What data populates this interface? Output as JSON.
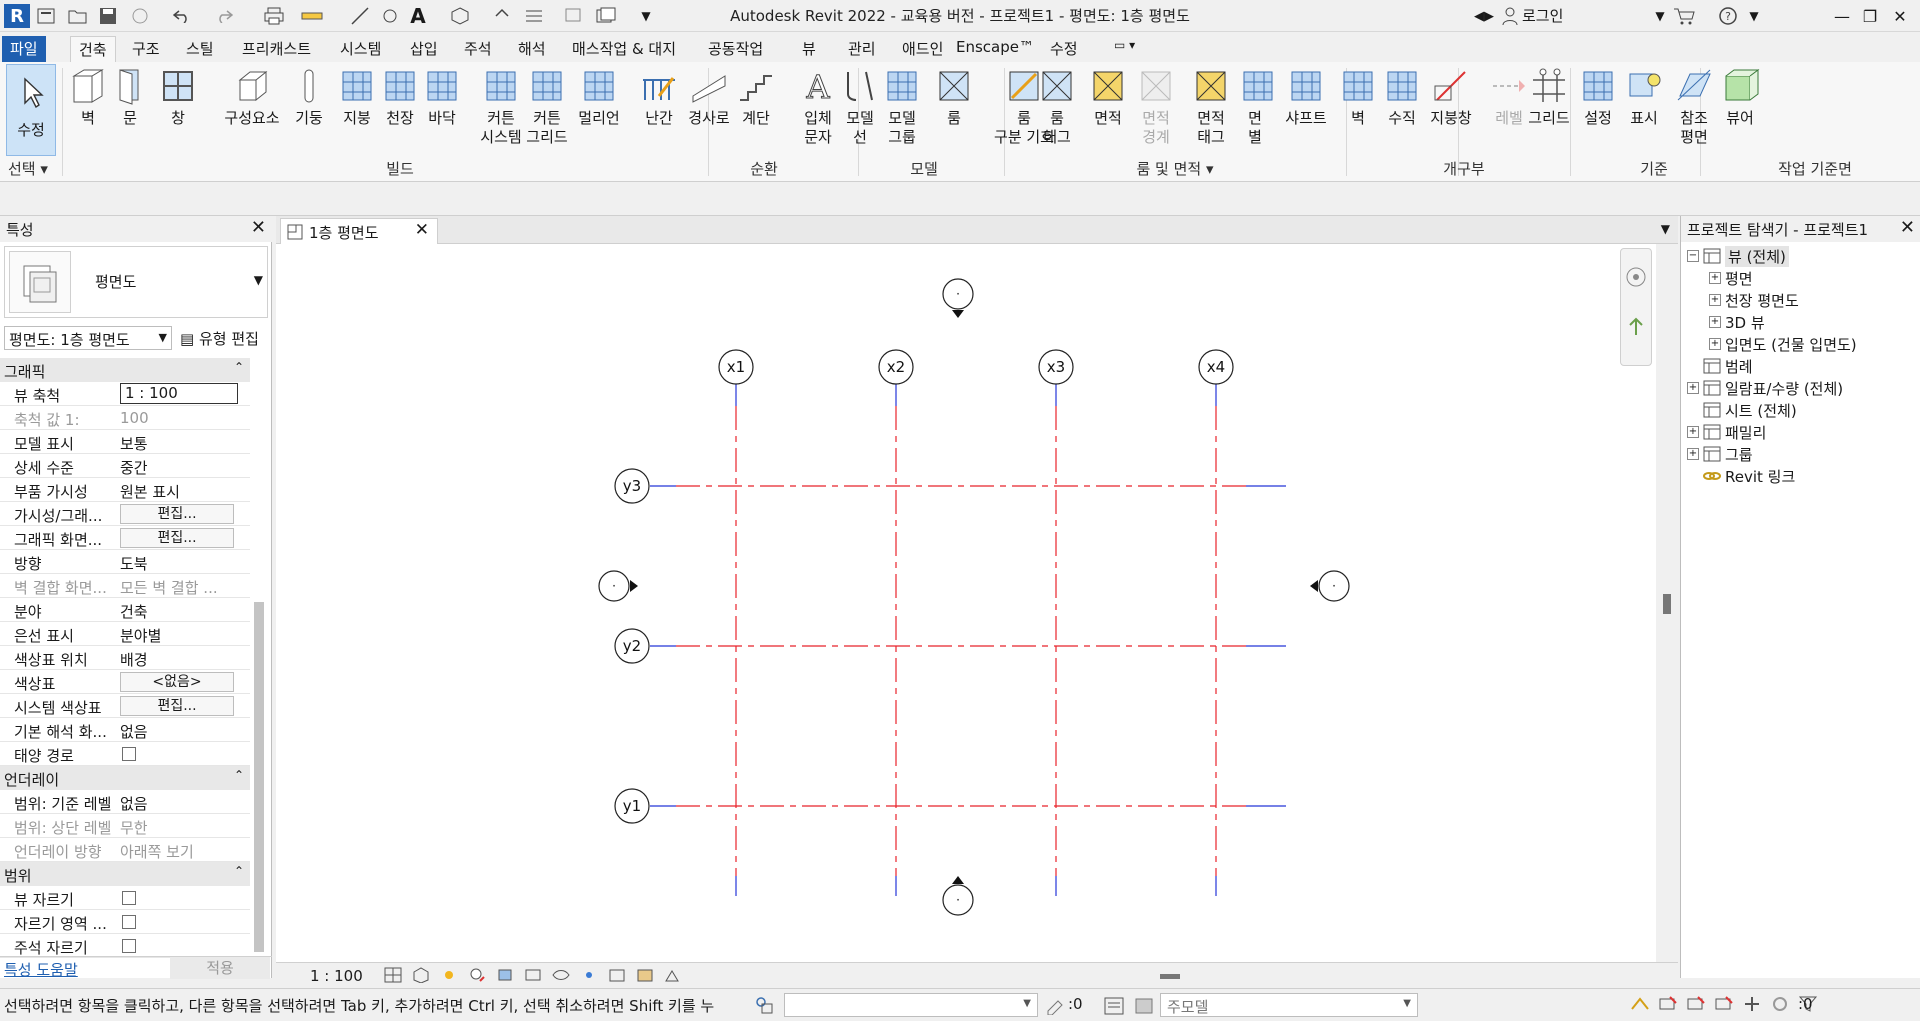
{
  "window": {
    "title": "Autodesk Revit 2022 - 교육용 버전 - 프로젝트1 - 평면도: 1층 평면도",
    "login": "로그인",
    "app_letter": "R"
  },
  "ribbon_tabs": [
    "파일",
    "건축",
    "구조",
    "스틸",
    "프리캐스트",
    "시스템",
    "삽입",
    "주석",
    "해석",
    "매스작업 & 대지",
    "공동작업",
    "뷰",
    "관리",
    "애드인",
    "Enscape™",
    "수정"
  ],
  "ribbon": {
    "select_label": "수정",
    "select_group": "선택",
    "groups": {
      "build": "빌드",
      "circulation": "순환",
      "model": "모델",
      "room_area": "룸 및 면적",
      "opening": "개구부",
      "datum": "기준",
      "work_plane": "작업 기준면"
    },
    "tools": [
      {
        "icon": "wall-icon",
        "line1": "벽",
        "line2": ""
      },
      {
        "icon": "door-icon",
        "line1": "문",
        "line2": ""
      },
      {
        "icon": "window-icon",
        "line1": "창",
        "line2": ""
      },
      {
        "icon": "component-icon",
        "line1": "구성요소",
        "line2": ""
      },
      {
        "icon": "column-icon",
        "line1": "기둥",
        "line2": ""
      },
      {
        "icon": "roof-icon",
        "line1": "지붕",
        "line2": ""
      },
      {
        "icon": "ceiling-icon",
        "line1": "천장",
        "line2": ""
      },
      {
        "icon": "floor-icon",
        "line1": "바닥",
        "line2": ""
      },
      {
        "icon": "curtain-system-icon",
        "line1": "커튼",
        "line2": "시스템"
      },
      {
        "icon": "curtain-grid-icon",
        "line1": "커튼",
        "line2": "그리드"
      },
      {
        "icon": "mullion-icon",
        "line1": "멀리언",
        "line2": ""
      },
      {
        "icon": "railing-icon",
        "line1": "난간",
        "line2": ""
      },
      {
        "icon": "ramp-icon",
        "line1": "경사로",
        "line2": ""
      },
      {
        "icon": "stair-icon",
        "line1": "계단",
        "line2": ""
      },
      {
        "icon": "model-text-icon",
        "line1": "입체",
        "line2": "문자"
      },
      {
        "icon": "model-line-icon",
        "line1": "모델",
        "line2": "선"
      },
      {
        "icon": "model-group-icon",
        "line1": "모델",
        "line2": "그룹"
      },
      {
        "icon": "room-icon",
        "line1": "룸",
        "line2": ""
      },
      {
        "icon": "room-separator-icon",
        "line1": "룸",
        "line2": "구분 기호"
      },
      {
        "icon": "room-tag-icon",
        "line1": "룸",
        "line2": "태그"
      },
      {
        "icon": "area-icon",
        "line1": "면적",
        "line2": ""
      },
      {
        "icon": "area-boundary-icon",
        "line1": "면적",
        "line2": "경계"
      },
      {
        "icon": "area-tag-icon",
        "line1": "면적",
        "line2": "태그"
      },
      {
        "icon": "by-face-icon",
        "line1": "면",
        "line2": "별"
      },
      {
        "icon": "shaft-icon",
        "line1": "샤프트",
        "line2": ""
      },
      {
        "icon": "wall-opening-icon",
        "line1": "벽",
        "line2": ""
      },
      {
        "icon": "vertical-opening-icon",
        "line1": "수직",
        "line2": ""
      },
      {
        "icon": "dormer-icon",
        "line1": "지붕창",
        "line2": ""
      },
      {
        "icon": "level-icon",
        "line1": "레벨",
        "line2": ""
      },
      {
        "icon": "grid-icon",
        "line1": "그리드",
        "line2": ""
      },
      {
        "icon": "set-workplane-icon",
        "line1": "설정",
        "line2": ""
      },
      {
        "icon": "show-workplane-icon",
        "line1": "표시",
        "line2": ""
      },
      {
        "icon": "ref-plane-icon",
        "line1": "참조",
        "line2": "평면"
      },
      {
        "icon": "viewer-icon",
        "line1": "뷰어",
        "line2": ""
      }
    ]
  },
  "properties": {
    "panel_title": "특성",
    "type_name": "평면도",
    "instance_selector": "평면도: 1층 평면도",
    "edit_type": "유형 편집",
    "sections": {
      "graphics": "그래픽",
      "underlay": "언더레이",
      "extents": "범위"
    },
    "graphics_rows": [
      {
        "k": "뷰 축척",
        "v": "1 : 100",
        "kind": "input"
      },
      {
        "k": "축척 값    1:",
        "v": "100",
        "kind": "dim"
      },
      {
        "k": "모델 표시",
        "v": "보통",
        "kind": "text"
      },
      {
        "k": "상세 수준",
        "v": "중간",
        "kind": "text"
      },
      {
        "k": "부품 가시성",
        "v": "원본 표시",
        "kind": "text"
      },
      {
        "k": "가시성/그래...",
        "v": "편집...",
        "kind": "button"
      },
      {
        "k": "그래픽 화면...",
        "v": "편집...",
        "kind": "button"
      },
      {
        "k": "방향",
        "v": "도북",
        "kind": "text"
      },
      {
        "k": "벽 결합 화면...",
        "v": "모든 벽 결합 ...",
        "kind": "dim"
      },
      {
        "k": "분야",
        "v": "건축",
        "kind": "text"
      },
      {
        "k": "은선 표시",
        "v": "분야별",
        "kind": "text"
      },
      {
        "k": "색상표 위치",
        "v": "배경",
        "kind": "text"
      },
      {
        "k": "색상표",
        "v": "<없음>",
        "kind": "button"
      },
      {
        "k": "시스템 색상표",
        "v": "편집...",
        "kind": "button"
      },
      {
        "k": "기본 해석 화...",
        "v": "없음",
        "kind": "text"
      },
      {
        "k": "태양 경로",
        "v": "",
        "kind": "check"
      }
    ],
    "underlay_rows": [
      {
        "k": "범위: 기준 레벨",
        "v": "없음",
        "kind": "text"
      },
      {
        "k": "범위: 상단 레벨",
        "v": "무한",
        "kind": "dim"
      },
      {
        "k": "언더레이 방향",
        "v": "아래쪽 보기",
        "kind": "dim"
      }
    ],
    "extents_rows": [
      {
        "k": "뷰 자르기",
        "v": "",
        "kind": "check"
      },
      {
        "k": "자르기 영역 ...",
        "v": "",
        "kind": "check"
      },
      {
        "k": "주석 자르기",
        "v": "",
        "kind": "check"
      }
    ],
    "help_link": "특성 도움말",
    "apply": "적용"
  },
  "view": {
    "tab_label": "1층 평면도",
    "scale": "1 : 100",
    "grid_x": [
      "x1",
      "x2",
      "x3",
      "x4"
    ],
    "grid_y": [
      "y3",
      "y2",
      "y1"
    ],
    "elevation_marker_label": "·"
  },
  "browser": {
    "title": "프로젝트 탐색기 - 프로젝트1",
    "nodes": [
      {
        "label": "뷰 (전체)",
        "level": 0,
        "exp": "−",
        "icon": "views-icon"
      },
      {
        "label": "평면",
        "level": 1,
        "exp": "+",
        "icon": ""
      },
      {
        "label": "천장 평면도",
        "level": 1,
        "exp": "+",
        "icon": ""
      },
      {
        "label": "3D 뷰",
        "level": 1,
        "exp": "+",
        "icon": ""
      },
      {
        "label": "입면도 (건물 입면도)",
        "level": 1,
        "exp": "+",
        "icon": ""
      },
      {
        "label": "범례",
        "level": 0,
        "exp": "",
        "icon": "legend-icon"
      },
      {
        "label": "일람표/수량 (전체)",
        "level": 0,
        "exp": "+",
        "icon": "schedule-icon"
      },
      {
        "label": "시트 (전체)",
        "level": 0,
        "exp": "",
        "icon": "sheet-icon"
      },
      {
        "label": "패밀리",
        "level": 0,
        "exp": "+",
        "icon": "family-icon"
      },
      {
        "label": "그룹",
        "level": 0,
        "exp": "+",
        "icon": "group-icon"
      },
      {
        "label": "Revit 링크",
        "level": 0,
        "exp": "",
        "icon": "link-icon"
      }
    ]
  },
  "status": {
    "message": "선택하려면 항목을 클릭하고, 다른 항목을 선택하려면 Tab 키, 추가하려면 Ctrl 키, 선택 취소하려면 Shift 키를 누",
    "count": ":0",
    "model_combo": "주모델",
    "filter_count": ":0"
  },
  "colors": {
    "accent": "#1f5fb0",
    "grid_red": "#e8232b",
    "grid_blue": "#2436d8",
    "select_bg": "#cde3f7"
  }
}
